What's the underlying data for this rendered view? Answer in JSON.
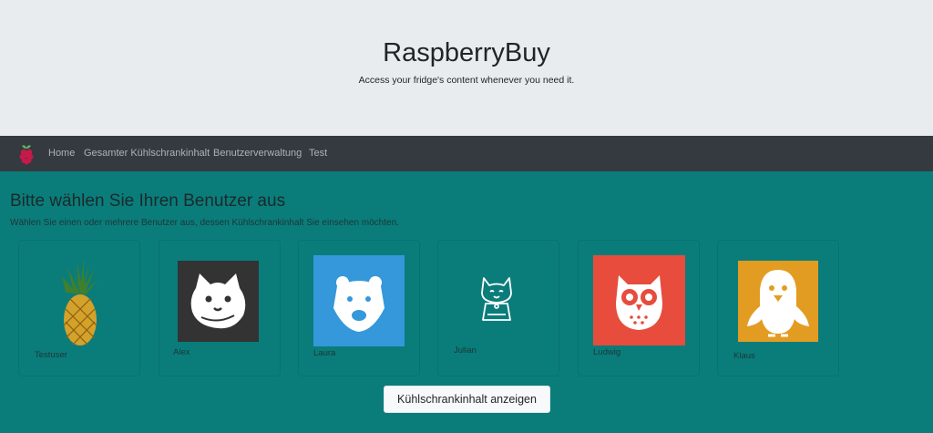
{
  "header": {
    "title": "RaspberryBuy",
    "subtitle": "Access your fridge's content whenever you need it."
  },
  "navbar": {
    "brand_icon": "raspberry-icon",
    "links": [
      "Home",
      "Gesamter Kühlschrankinhalt",
      "Benutzerverwaltung",
      "Test"
    ]
  },
  "main": {
    "heading": "Bitte wählen Sie Ihren Benutzer aus",
    "description": "Wählen Sie einen oder mehrere Benutzer aus, dessen Kühlschrankinhalt Sie einsehen möchten.",
    "users": [
      {
        "name": "Testuser",
        "icon": "pineapple-icon"
      },
      {
        "name": "Alex",
        "icon": "hamster-icon",
        "color": "#333333"
      },
      {
        "name": "Laura",
        "icon": "bear-icon",
        "color": "#3498db"
      },
      {
        "name": "Julian",
        "icon": "cat-icon"
      },
      {
        "name": "Ludwig",
        "icon": "owl-icon",
        "color": "#e74c3c"
      },
      {
        "name": "Klaus",
        "icon": "penguin-icon",
        "color": "#e39c22"
      }
    ],
    "submit_label": "Kühlschrankinhalt anzeigen"
  },
  "colors": {
    "background": "#0a7d7b",
    "jumbotron": "#e9ecef",
    "navbar": "#343a40"
  }
}
